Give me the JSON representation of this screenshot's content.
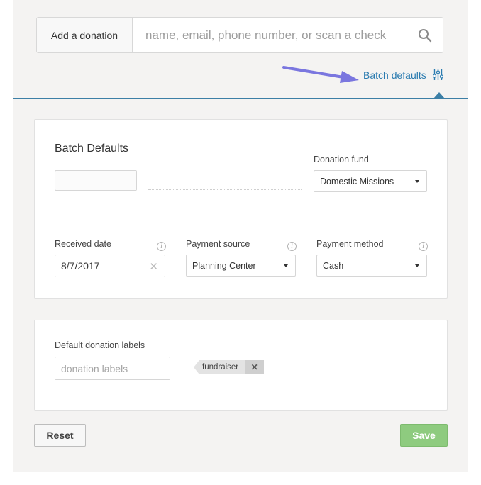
{
  "search": {
    "prefix_label": "Add a donation",
    "placeholder": "name, email, phone number, or scan a check",
    "icon": "search-icon"
  },
  "batch_link": {
    "label": "Batch defaults",
    "icon": "sliders-icon"
  },
  "colors": {
    "accent": "#2a7bb0",
    "arrow": "#7a76df",
    "save": "#8ecb7f",
    "background": "#f4f3f2"
  },
  "batch_defaults": {
    "title": "Batch Defaults",
    "donation_fund": {
      "label": "Donation fund",
      "value": "Domestic Missions"
    },
    "received_date": {
      "label": "Received date",
      "value": "8/7/2017"
    },
    "payment_source": {
      "label": "Payment source",
      "value": "Planning Center"
    },
    "payment_method": {
      "label": "Payment method",
      "value": "Cash"
    }
  },
  "labels_section": {
    "label": "Default donation labels",
    "placeholder": "donation labels",
    "tags": [
      "fundraiser"
    ]
  },
  "buttons": {
    "reset": "Reset",
    "save": "Save"
  }
}
